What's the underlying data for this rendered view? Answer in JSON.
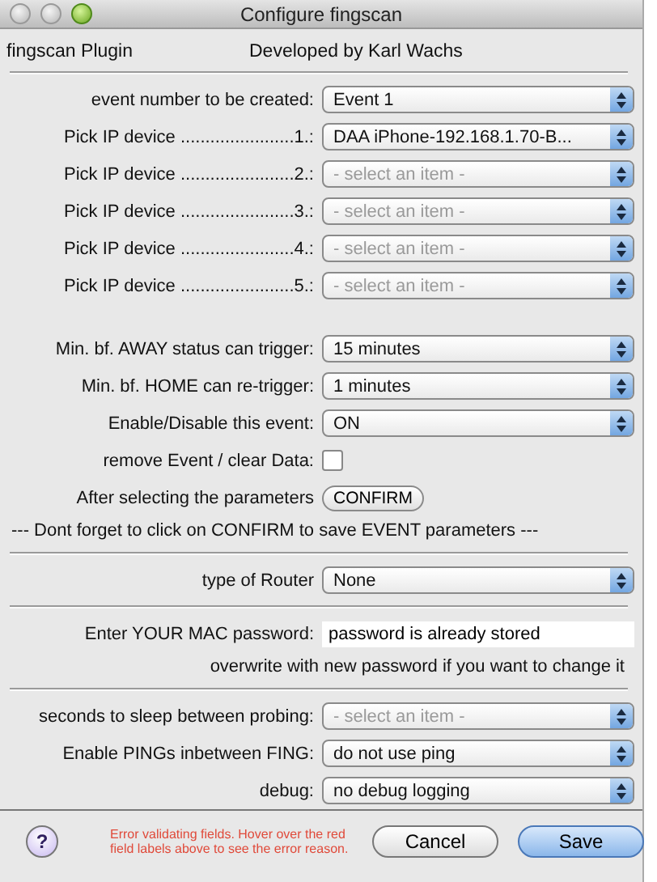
{
  "window": {
    "title": "Configure fingscan"
  },
  "header": {
    "left": "fingscan Plugin",
    "right": "Developed by Karl Wachs"
  },
  "rows": [
    {
      "kind": "select",
      "label": "event number to be created:",
      "value": "Event 1"
    },
    {
      "kind": "select",
      "label": "Pick IP device .......................1.:",
      "value": "DAA iPhone-192.168.1.70-B..."
    },
    {
      "kind": "select",
      "label": "Pick IP device .......................2.:",
      "placeholder": "- select an item -"
    },
    {
      "kind": "select",
      "label": "Pick IP device .......................3.:",
      "placeholder": "- select an item -"
    },
    {
      "kind": "select",
      "label": "Pick IP device .......................4.:",
      "placeholder": "- select an item -"
    },
    {
      "kind": "select",
      "label": "Pick IP device .......................5.:",
      "placeholder": "- select an item -"
    },
    {
      "kind": "spacer"
    },
    {
      "kind": "select",
      "label": "Min. bf. AWAY status can trigger:",
      "value": "15 minutes"
    },
    {
      "kind": "select",
      "label": "Min. bf. HOME can re-trigger:",
      "value": "1 minutes"
    },
    {
      "kind": "select",
      "label": "Enable/Disable this event:",
      "value": "ON"
    },
    {
      "kind": "checkbox",
      "label": "remove Event / clear Data:",
      "checked": false
    },
    {
      "kind": "button",
      "label": "After selecting the parameters",
      "button": "CONFIRM"
    },
    {
      "kind": "note",
      "text": "--- Dont forget to click on CONFIRM to save EVENT parameters ---"
    },
    {
      "kind": "separator"
    },
    {
      "kind": "select",
      "label": "type of Router",
      "value": "None"
    },
    {
      "kind": "separator"
    },
    {
      "kind": "textfield",
      "label": "Enter YOUR MAC password:",
      "value": "password is already stored"
    },
    {
      "kind": "hint",
      "text": "overwrite with new password if you want to change it"
    },
    {
      "kind": "separator"
    },
    {
      "kind": "select",
      "label": "seconds to sleep between probing:",
      "placeholder": "- select an item -"
    },
    {
      "kind": "select",
      "label": "Enable PINGs inbetween FING:",
      "value": "do not use ping"
    },
    {
      "kind": "select",
      "label": "debug:",
      "value": "no debug logging"
    }
  ],
  "footer": {
    "help": "?",
    "error": "Error validating fields. Hover over the red field labels above to see the error reason.",
    "buttons": [
      {
        "label": "Cancel",
        "primary": false
      },
      {
        "label": "Save",
        "primary": true
      }
    ]
  }
}
